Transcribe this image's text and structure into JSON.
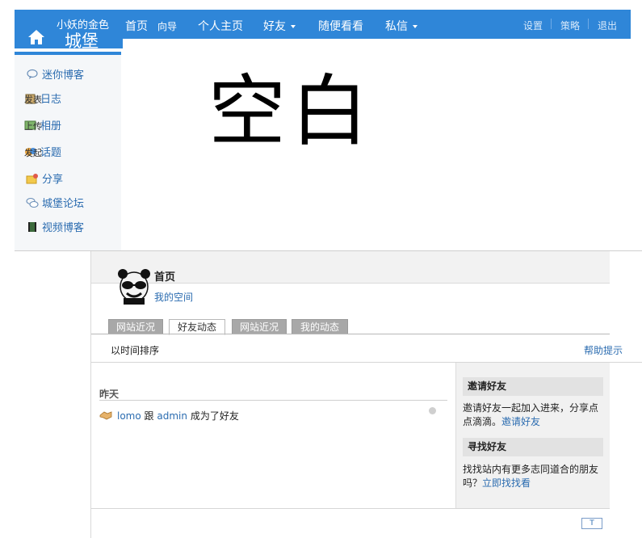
{
  "header": {
    "logo_small": "小妖的金色",
    "logo_big": "城堡",
    "nav": [
      {
        "label": "首页"
      },
      {
        "label": "向导"
      },
      {
        "label": "个人主页"
      },
      {
        "label": "好友"
      },
      {
        "label": "随便看看"
      },
      {
        "label": "私信"
      }
    ],
    "right_links": [
      {
        "label": "设置"
      },
      {
        "label": "策略"
      },
      {
        "label": "退出"
      }
    ]
  },
  "sidebar": {
    "items": [
      {
        "label": "迷你博客",
        "icon": "chat-bubble-icon"
      },
      {
        "label": "日志",
        "overlay": "发表",
        "icon": "journal-icon"
      },
      {
        "label": "相册",
        "overlay": "上传",
        "icon": "photo-album-icon"
      },
      {
        "label": "话题",
        "overlay": "发起",
        "icon": "topic-icon"
      },
      {
        "label": "分享",
        "icon": "share-icon"
      },
      {
        "label": "城堡论坛",
        "icon": "forum-icon"
      },
      {
        "label": "视频博客",
        "icon": "film-icon"
      }
    ]
  },
  "placeholder_text": "空白",
  "panel": {
    "title": "首页",
    "my_space": "我的空间",
    "tabs": [
      {
        "label": "网站近况",
        "active": false
      },
      {
        "label": "好友动态",
        "active": true
      },
      {
        "label": "网站近况",
        "active": false
      },
      {
        "label": "我的动态",
        "active": false
      }
    ],
    "sort_label": "以时间排序",
    "help_link": "帮助提示",
    "feed": {
      "day_label": "昨天",
      "item": {
        "user_a": "lomo",
        "connector": "跟",
        "user_b": "admin",
        "action": "成为了好友"
      }
    },
    "right_column": {
      "invite_title": "邀请好友",
      "invite_text": "邀请好友一起加入进来，分享点点滴滴。",
      "invite_link": "邀请好友",
      "find_title": "寻找好友",
      "find_text": "找找站内有更多志同道合的朋友吗？",
      "find_link": "立即找找看"
    },
    "corner_button": "T"
  },
  "colors": {
    "brand_blue": "#2f86d8",
    "link_blue": "#2b6cb0",
    "tab_gray": "#a8a8a8"
  }
}
